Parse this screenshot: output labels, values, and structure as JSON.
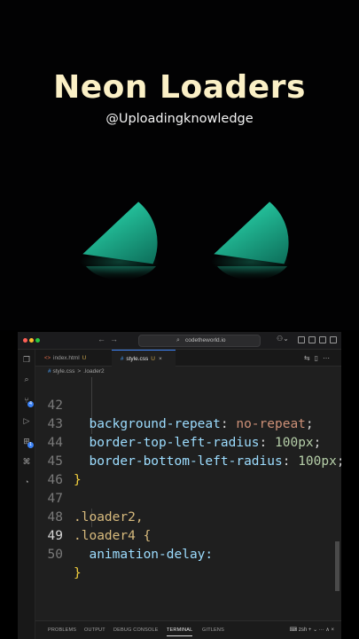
{
  "hero": {
    "title": "Neon Loaders",
    "subtitle": "@Uploadingknowledge",
    "loader_color": "#2ee0b0"
  },
  "vscode": {
    "window_controls": [
      "#ff5f57",
      "#febc2e",
      "#28c840"
    ],
    "search_text": "codetheworld.io",
    "activity_icons": [
      "files-icon",
      "search-icon",
      "source-control-icon",
      "run-debug-icon",
      "extensions-icon",
      "remote-icon",
      "accounts-icon"
    ],
    "badges": {
      "source_control": "4",
      "extensions": "1"
    },
    "tabs": [
      {
        "icon": "<>",
        "label": "index.html",
        "status": "U"
      },
      {
        "icon": "#",
        "label": "style.css",
        "status": "U",
        "close": "×"
      }
    ],
    "breadcrumb": {
      "file_icon": "#",
      "file": "style.css",
      "separator": ">",
      "symbol": ".loader2"
    },
    "lines": [
      {
        "n": "42",
        "indent": "  ",
        "prop": "background-repeat",
        "value": "no-repeat",
        "vtype": "val"
      },
      {
        "n": "43",
        "indent": "  ",
        "prop": "border-top-left-radius",
        "value": "100px",
        "vtype": "num"
      },
      {
        "n": "44",
        "indent": "  ",
        "prop": "border-bottom-left-radius",
        "value": "100px",
        "vtype": "num"
      },
      {
        "n": "45",
        "text": "}"
      },
      {
        "n": "46",
        "text": ""
      },
      {
        "n": "47",
        "text": ".loader2,"
      },
      {
        "n": "48",
        "text": ".loader4 {"
      },
      {
        "n": "49",
        "text": "  animation-delay:"
      },
      {
        "n": "50",
        "text": "}"
      }
    ],
    "panel_tabs": [
      "PROBLEMS",
      "OUTPUT",
      "DEBUG CONSOLE",
      "TERMINAL",
      "GITLENS"
    ],
    "active_panel_tab": "TERMINAL",
    "terminal_shell": "zsh",
    "panel_actions": "+ ⌄ ··· ∧ ×"
  }
}
